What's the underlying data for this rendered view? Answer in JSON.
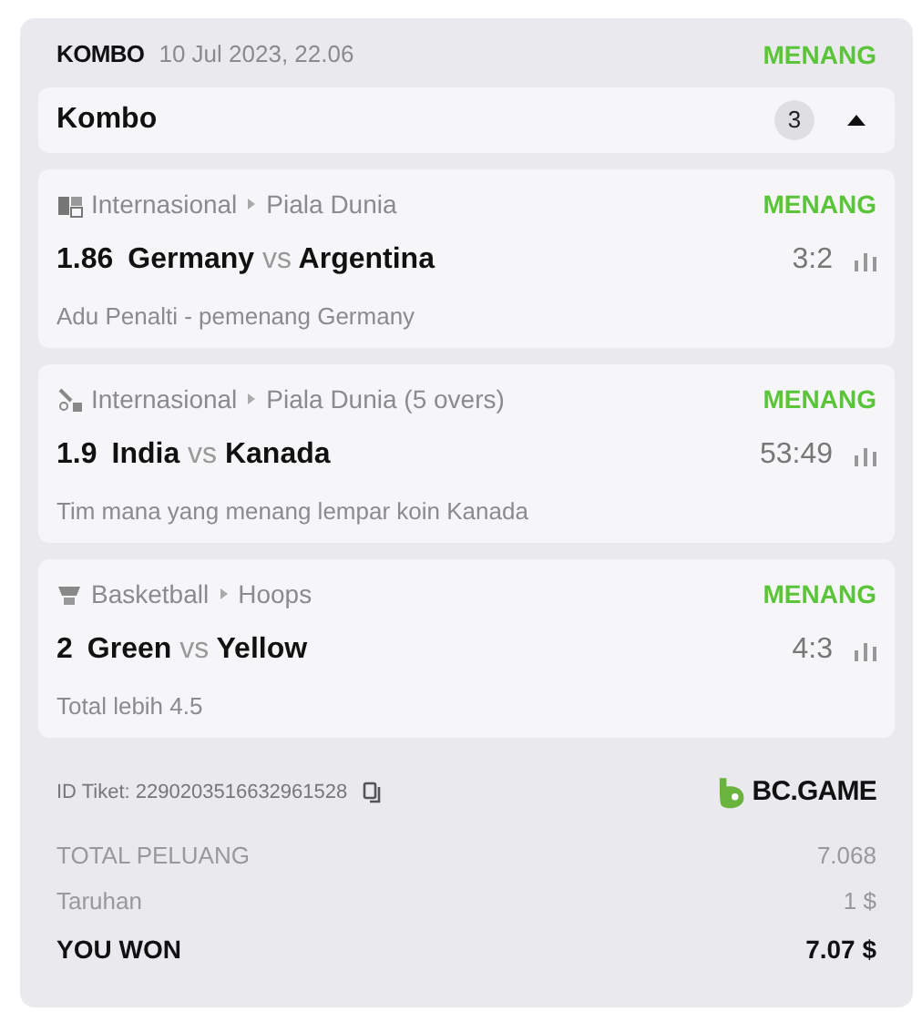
{
  "header": {
    "type": "KOMBO",
    "date": "10 Jul 2023, 22.06",
    "status": "MENANG"
  },
  "combo": {
    "title": "Kombo",
    "count": "3",
    "expanded": true
  },
  "bets": [
    {
      "kind": "fifa",
      "category": "Internasional",
      "league": "Piala Dunia",
      "status": "MENANG",
      "odds": "1.86",
      "home": "Germany",
      "vs": "vs",
      "away": "Argentina",
      "score": "3:2",
      "market": "Adu Penalti - pemenang Germany"
    },
    {
      "kind": "cricket",
      "category": "Internasional",
      "league": "Piala Dunia (5 overs)",
      "status": "MENANG",
      "odds": "1.9",
      "home": "India",
      "vs": "vs",
      "away": "Kanada",
      "score": "53:49",
      "market": "Tim mana yang menang lempar koin Kanada"
    },
    {
      "kind": "basketball",
      "category": "Basketball",
      "league": "Hoops",
      "status": "MENANG",
      "odds": "2",
      "home": "Green",
      "vs": "vs",
      "away": "Yellow",
      "score": "4:3",
      "market": "Total lebih 4.5"
    }
  ],
  "ticket": {
    "id": "ID Tiket: 2290203516632961528",
    "brand": "BC.GAME"
  },
  "summary": [
    {
      "label": "TOTAL PELUANG",
      "value": "7.068",
      "kind": "muted"
    },
    {
      "label": "Taruhan",
      "value": "1 $",
      "kind": "muted"
    },
    {
      "label": "YOU WON",
      "value": "7.07 $",
      "kind": "total"
    }
  ]
}
